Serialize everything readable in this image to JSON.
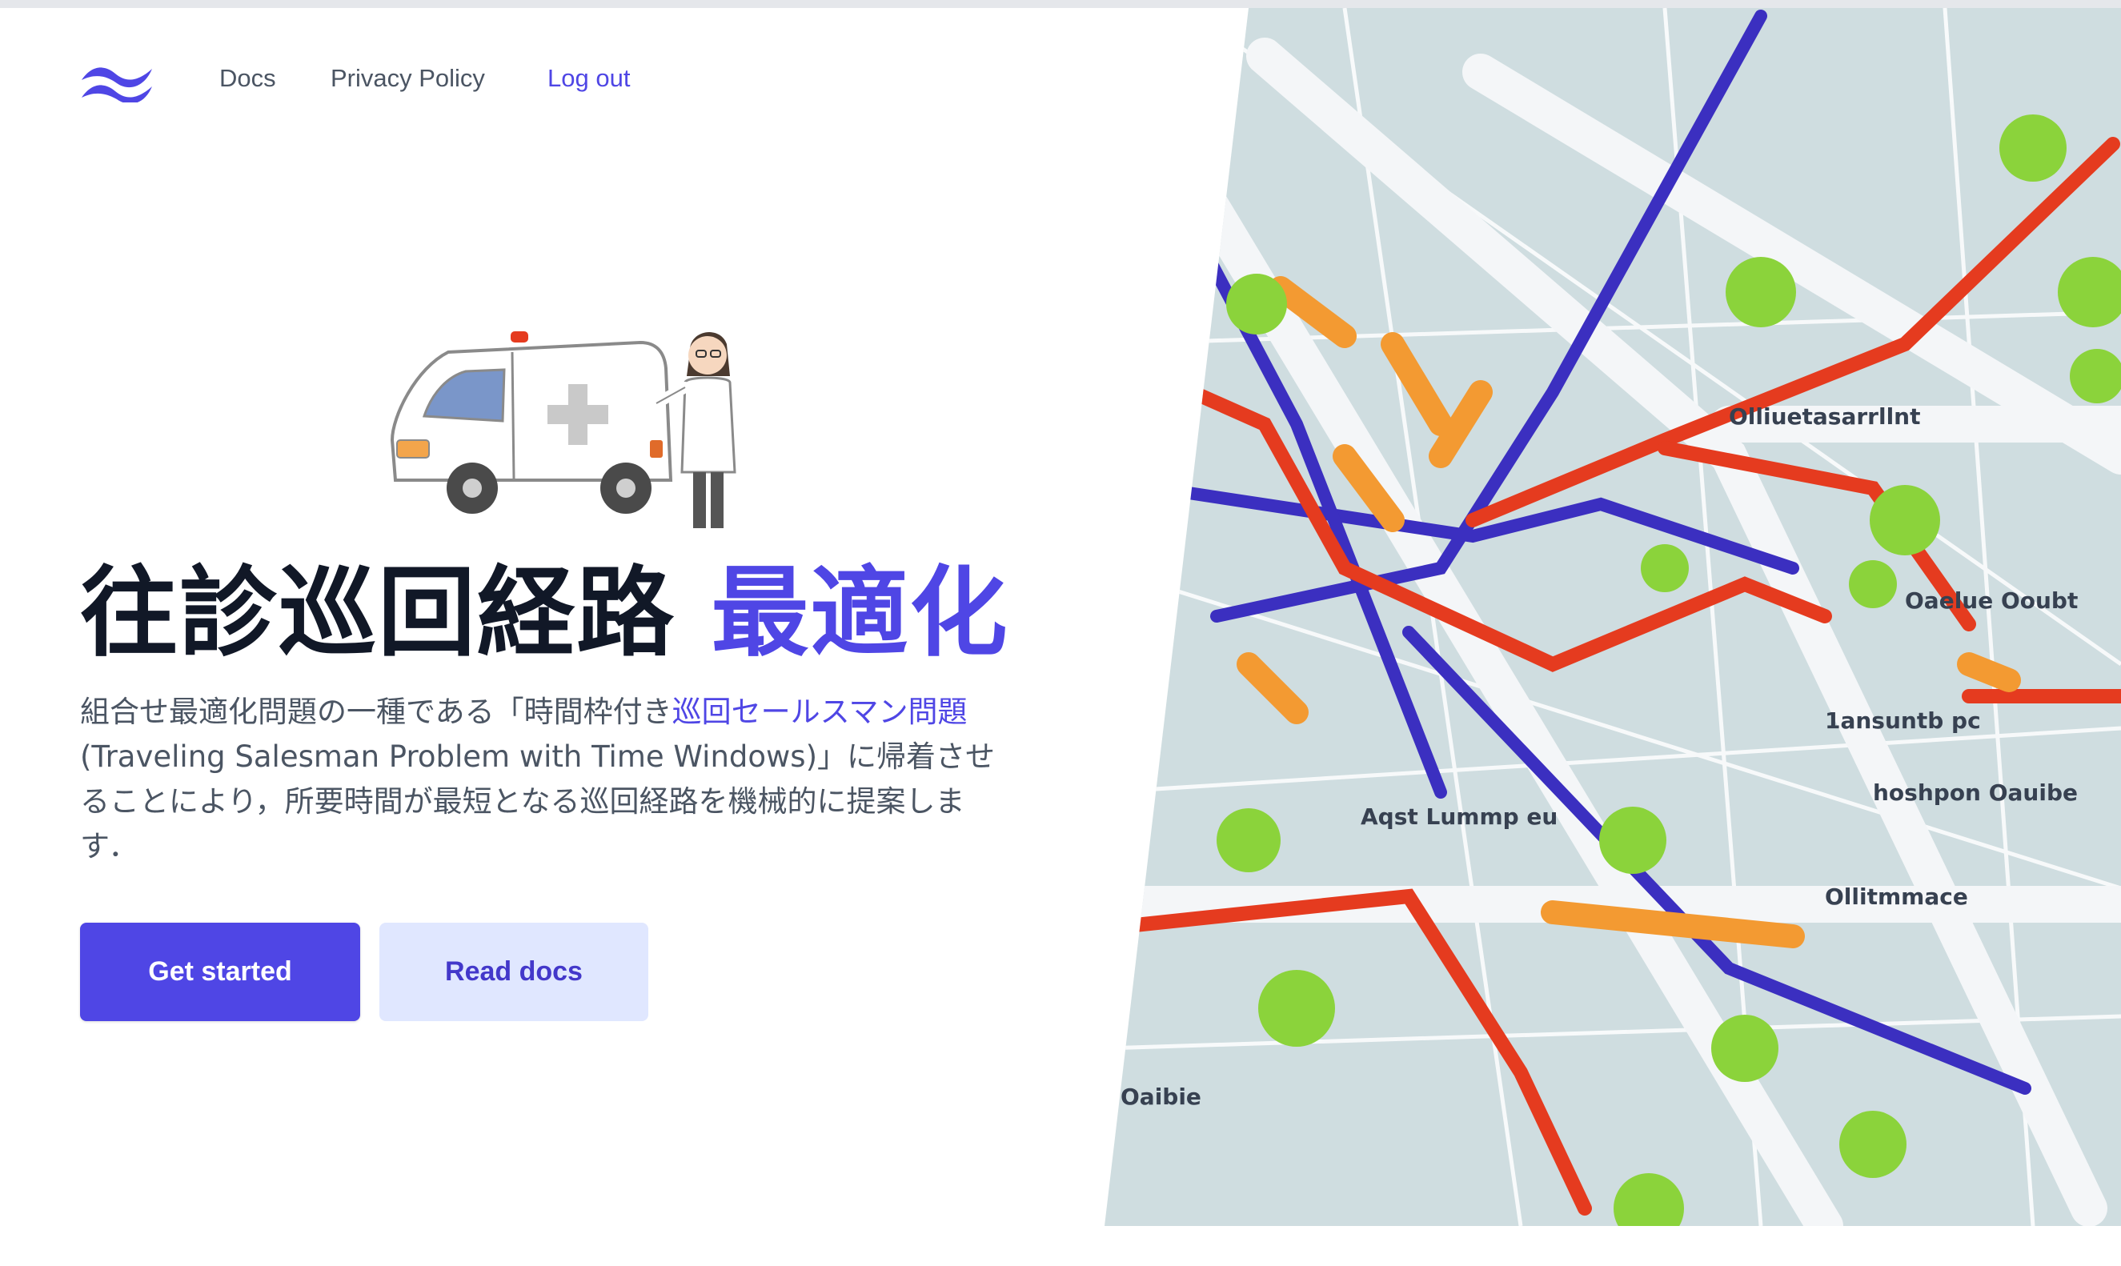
{
  "nav": {
    "logo_name": "tailwind-wave-logo",
    "links": [
      "Docs",
      "Privacy Policy",
      "Log out"
    ]
  },
  "hero": {
    "title_main": "往診巡回経路",
    "title_accent": "最適化",
    "description_before": "組合せ最適化問題の一種である「時間枠付き",
    "description_highlight": "巡回セールスマン問題",
    "description_after": "(Traveling Salesman Problem with Time Windows)」に帰着させることにより，所要時間が最短となる巡回経路を機械的に提案します．",
    "primary_button": "Get started",
    "secondary_button": "Read docs"
  },
  "map_labels": [
    "Olliuetasarrllnt",
    "Oaelue Ooubt",
    "1ansuntb pc",
    "hoshpon Oauibe",
    "Aqst Lummp eu",
    "Ollitmmace",
    "Oaibie"
  ],
  "colors": {
    "accent": "#4f46e5",
    "accent_light": "#e0e7ff",
    "route_red": "#e53b1f",
    "route_blue": "#3b2fc0",
    "route_orange": "#f39a32",
    "node_green": "#8bd33b",
    "map_bg": "#cfdde0"
  }
}
